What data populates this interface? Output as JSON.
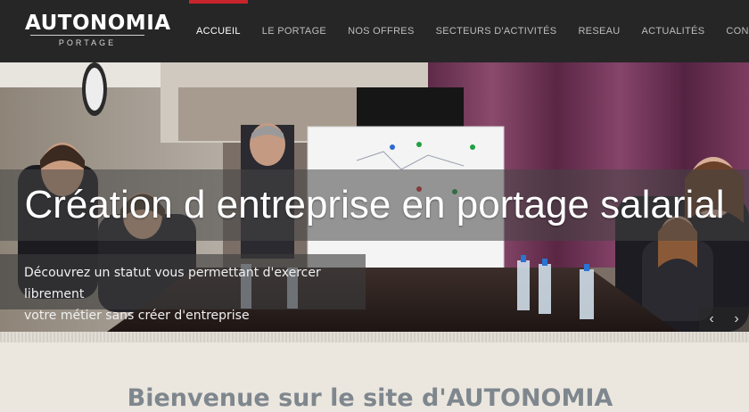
{
  "header": {
    "logo_main": "AUTONOMIA",
    "logo_sub": "PORTAGE",
    "nav": [
      {
        "label": "ACCUEIL",
        "active": true
      },
      {
        "label": "LE PORTAGE",
        "active": false
      },
      {
        "label": "NOS OFFRES",
        "active": false
      },
      {
        "label": "SECTEURS D'ACTIVITÉS",
        "active": false
      },
      {
        "label": "RESEAU",
        "active": false
      },
      {
        "label": "ACTUALITÉS",
        "active": false
      },
      {
        "label": "CONTACT",
        "active": false
      }
    ],
    "accent_color": "#c8242b"
  },
  "hero": {
    "title": "Création d entreprise en portage salarial",
    "subtitle_line1": "Découvrez un statut vous permettant d'exercer librement",
    "subtitle_line2": "votre métier sans créer d'entreprise",
    "prev_icon": "‹",
    "next_icon": "›"
  },
  "main": {
    "welcome": "Bienvenue sur le site d'AUTONOMIA"
  }
}
